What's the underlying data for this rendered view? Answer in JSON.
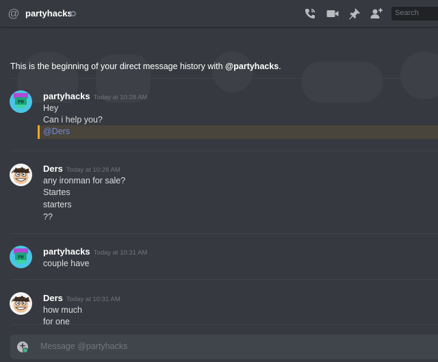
{
  "header": {
    "channel_icon": "at-icon",
    "title": "partyhacks",
    "status": "offline",
    "icons": [
      "phone-call-icon",
      "video-call-icon",
      "pin-icon",
      "add-friend-icon"
    ],
    "search_placeholder": "Search"
  },
  "intro": {
    "prefix": "This is the beginning of your direct message history with ",
    "handle": "@partyhacks",
    "suffix": "."
  },
  "messages": [
    {
      "author": "partyhacks",
      "timestamp": "Today at 10:28 AM",
      "avatar": "partyhacks-avatar",
      "lines": [
        "Hey",
        "Can i help you?"
      ],
      "mention": "@Ders"
    },
    {
      "author": "Ders",
      "timestamp": "Today at 10:28 AM",
      "avatar": "ders-avatar",
      "lines": [
        "any ironman for sale?",
        "Startes",
        "starters",
        "??"
      ]
    },
    {
      "author": "partyhacks",
      "timestamp": "Today at 10:31 AM",
      "avatar": "partyhacks-avatar",
      "lines": [
        "couple have"
      ]
    },
    {
      "author": "Ders",
      "timestamp": "Today at 10:31 AM",
      "avatar": "ders-avatar",
      "lines": [
        "how much",
        "for one"
      ]
    }
  ],
  "composer": {
    "placeholder": "Message @partyhacks"
  },
  "colors": {
    "background": "#36393f",
    "mention_highlight": "#faa61a",
    "mention_link": "#7289da"
  }
}
